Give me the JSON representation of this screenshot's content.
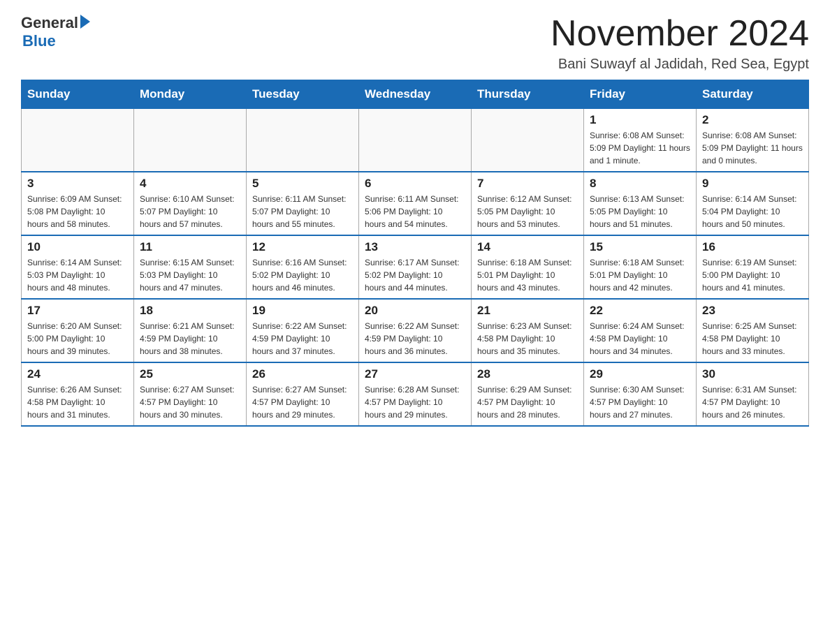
{
  "header": {
    "logo": {
      "general": "General",
      "blue": "Blue",
      "aria": "GeneralBlue logo"
    },
    "title": "November 2024",
    "location": "Bani Suwayf al Jadidah, Red Sea, Egypt"
  },
  "days_of_week": [
    "Sunday",
    "Monday",
    "Tuesday",
    "Wednesday",
    "Thursday",
    "Friday",
    "Saturday"
  ],
  "weeks": [
    [
      {
        "day": "",
        "info": ""
      },
      {
        "day": "",
        "info": ""
      },
      {
        "day": "",
        "info": ""
      },
      {
        "day": "",
        "info": ""
      },
      {
        "day": "",
        "info": ""
      },
      {
        "day": "1",
        "info": "Sunrise: 6:08 AM\nSunset: 5:09 PM\nDaylight: 11 hours and 1 minute."
      },
      {
        "day": "2",
        "info": "Sunrise: 6:08 AM\nSunset: 5:09 PM\nDaylight: 11 hours and 0 minutes."
      }
    ],
    [
      {
        "day": "3",
        "info": "Sunrise: 6:09 AM\nSunset: 5:08 PM\nDaylight: 10 hours and 58 minutes."
      },
      {
        "day": "4",
        "info": "Sunrise: 6:10 AM\nSunset: 5:07 PM\nDaylight: 10 hours and 57 minutes."
      },
      {
        "day": "5",
        "info": "Sunrise: 6:11 AM\nSunset: 5:07 PM\nDaylight: 10 hours and 55 minutes."
      },
      {
        "day": "6",
        "info": "Sunrise: 6:11 AM\nSunset: 5:06 PM\nDaylight: 10 hours and 54 minutes."
      },
      {
        "day": "7",
        "info": "Sunrise: 6:12 AM\nSunset: 5:05 PM\nDaylight: 10 hours and 53 minutes."
      },
      {
        "day": "8",
        "info": "Sunrise: 6:13 AM\nSunset: 5:05 PM\nDaylight: 10 hours and 51 minutes."
      },
      {
        "day": "9",
        "info": "Sunrise: 6:14 AM\nSunset: 5:04 PM\nDaylight: 10 hours and 50 minutes."
      }
    ],
    [
      {
        "day": "10",
        "info": "Sunrise: 6:14 AM\nSunset: 5:03 PM\nDaylight: 10 hours and 48 minutes."
      },
      {
        "day": "11",
        "info": "Sunrise: 6:15 AM\nSunset: 5:03 PM\nDaylight: 10 hours and 47 minutes."
      },
      {
        "day": "12",
        "info": "Sunrise: 6:16 AM\nSunset: 5:02 PM\nDaylight: 10 hours and 46 minutes."
      },
      {
        "day": "13",
        "info": "Sunrise: 6:17 AM\nSunset: 5:02 PM\nDaylight: 10 hours and 44 minutes."
      },
      {
        "day": "14",
        "info": "Sunrise: 6:18 AM\nSunset: 5:01 PM\nDaylight: 10 hours and 43 minutes."
      },
      {
        "day": "15",
        "info": "Sunrise: 6:18 AM\nSunset: 5:01 PM\nDaylight: 10 hours and 42 minutes."
      },
      {
        "day": "16",
        "info": "Sunrise: 6:19 AM\nSunset: 5:00 PM\nDaylight: 10 hours and 41 minutes."
      }
    ],
    [
      {
        "day": "17",
        "info": "Sunrise: 6:20 AM\nSunset: 5:00 PM\nDaylight: 10 hours and 39 minutes."
      },
      {
        "day": "18",
        "info": "Sunrise: 6:21 AM\nSunset: 4:59 PM\nDaylight: 10 hours and 38 minutes."
      },
      {
        "day": "19",
        "info": "Sunrise: 6:22 AM\nSunset: 4:59 PM\nDaylight: 10 hours and 37 minutes."
      },
      {
        "day": "20",
        "info": "Sunrise: 6:22 AM\nSunset: 4:59 PM\nDaylight: 10 hours and 36 minutes."
      },
      {
        "day": "21",
        "info": "Sunrise: 6:23 AM\nSunset: 4:58 PM\nDaylight: 10 hours and 35 minutes."
      },
      {
        "day": "22",
        "info": "Sunrise: 6:24 AM\nSunset: 4:58 PM\nDaylight: 10 hours and 34 minutes."
      },
      {
        "day": "23",
        "info": "Sunrise: 6:25 AM\nSunset: 4:58 PM\nDaylight: 10 hours and 33 minutes."
      }
    ],
    [
      {
        "day": "24",
        "info": "Sunrise: 6:26 AM\nSunset: 4:58 PM\nDaylight: 10 hours and 31 minutes."
      },
      {
        "day": "25",
        "info": "Sunrise: 6:27 AM\nSunset: 4:57 PM\nDaylight: 10 hours and 30 minutes."
      },
      {
        "day": "26",
        "info": "Sunrise: 6:27 AM\nSunset: 4:57 PM\nDaylight: 10 hours and 29 minutes."
      },
      {
        "day": "27",
        "info": "Sunrise: 6:28 AM\nSunset: 4:57 PM\nDaylight: 10 hours and 29 minutes."
      },
      {
        "day": "28",
        "info": "Sunrise: 6:29 AM\nSunset: 4:57 PM\nDaylight: 10 hours and 28 minutes."
      },
      {
        "day": "29",
        "info": "Sunrise: 6:30 AM\nSunset: 4:57 PM\nDaylight: 10 hours and 27 minutes."
      },
      {
        "day": "30",
        "info": "Sunrise: 6:31 AM\nSunset: 4:57 PM\nDaylight: 10 hours and 26 minutes."
      }
    ]
  ]
}
